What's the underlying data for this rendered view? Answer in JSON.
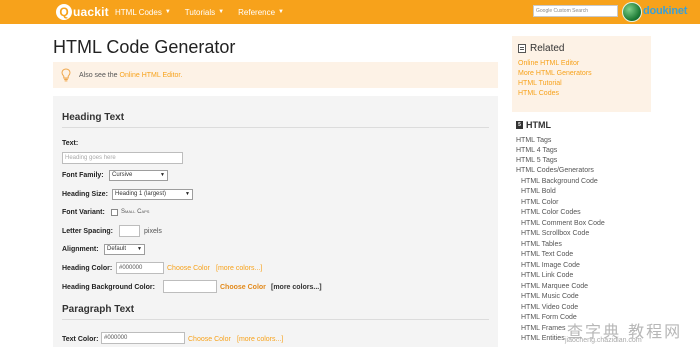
{
  "nav": {
    "logo_letter": "Q",
    "logo_text": "uackit",
    "menu": [
      {
        "label": "HTML Codes"
      },
      {
        "label": "Tutorials"
      },
      {
        "label": "Reference"
      }
    ],
    "caret_icon": "caret-down-icon",
    "search_placeholder": "Google Custom Search",
    "partner_text": "doukinet"
  },
  "main": {
    "title": "HTML Code Generator",
    "tip_icon": "lightbulb-icon",
    "tip_prefix": "Also see the",
    "tip_link": "Online HTML Editor."
  },
  "form": {
    "heading_section": "Heading Text",
    "text_label": "Text:",
    "text_placeholder": "Heading goes here",
    "font_family_label": "Font Family:",
    "font_family_value": "Cursive",
    "heading_size_label": "Heading Size:",
    "heading_size_value": "Heading 1 (largest)",
    "font_variant_label": "Font Variant:",
    "font_variant_option": "Small Caps",
    "letter_spacing_label": "Letter Spacing:",
    "letter_spacing_unit": "pixels",
    "alignment_label": "Alignment:",
    "alignment_value": "Default",
    "heading_color_label": "Heading Color:",
    "heading_color_value": "#000000",
    "choose_color": "Choose Color",
    "more_colors": "[more colors...]",
    "heading_bg_label": "Heading Background Color:",
    "paragraph_section": "Paragraph Text",
    "text_color_label": "Text Color:",
    "text_color_value": "#000000"
  },
  "related": {
    "title": "Related",
    "links": [
      "Online HTML Editor",
      "More HTML Generators",
      "HTML Tutorial",
      "HTML Codes"
    ]
  },
  "sidebar": {
    "heading": "HTML",
    "heading_icon": "html5-icon",
    "links": [
      "HTML Tags",
      "HTML 4 Tags",
      "HTML 5 Tags",
      "HTML Codes/Generators"
    ],
    "sublinks": [
      "HTML Background Code",
      "HTML Bold",
      "HTML Color",
      "HTML Color Codes",
      "HTML Comment Box Code",
      "HTML Scrollbox Code",
      "HTML Tables",
      "HTML Text Code",
      "HTML Image Code",
      "HTML Link Code",
      "HTML Marquee Code",
      "HTML Music Code",
      "HTML Video Code",
      "HTML Form Code",
      "HTML Frames",
      "HTML Entities"
    ]
  },
  "watermark": {
    "main": "查字典 教程网",
    "sub": "jiaocheng.chazidian.com"
  },
  "colors": {
    "brand_orange": "#f7a21b",
    "tip_bg": "#fdf2e6",
    "panel_bg": "#f4f4f4"
  }
}
